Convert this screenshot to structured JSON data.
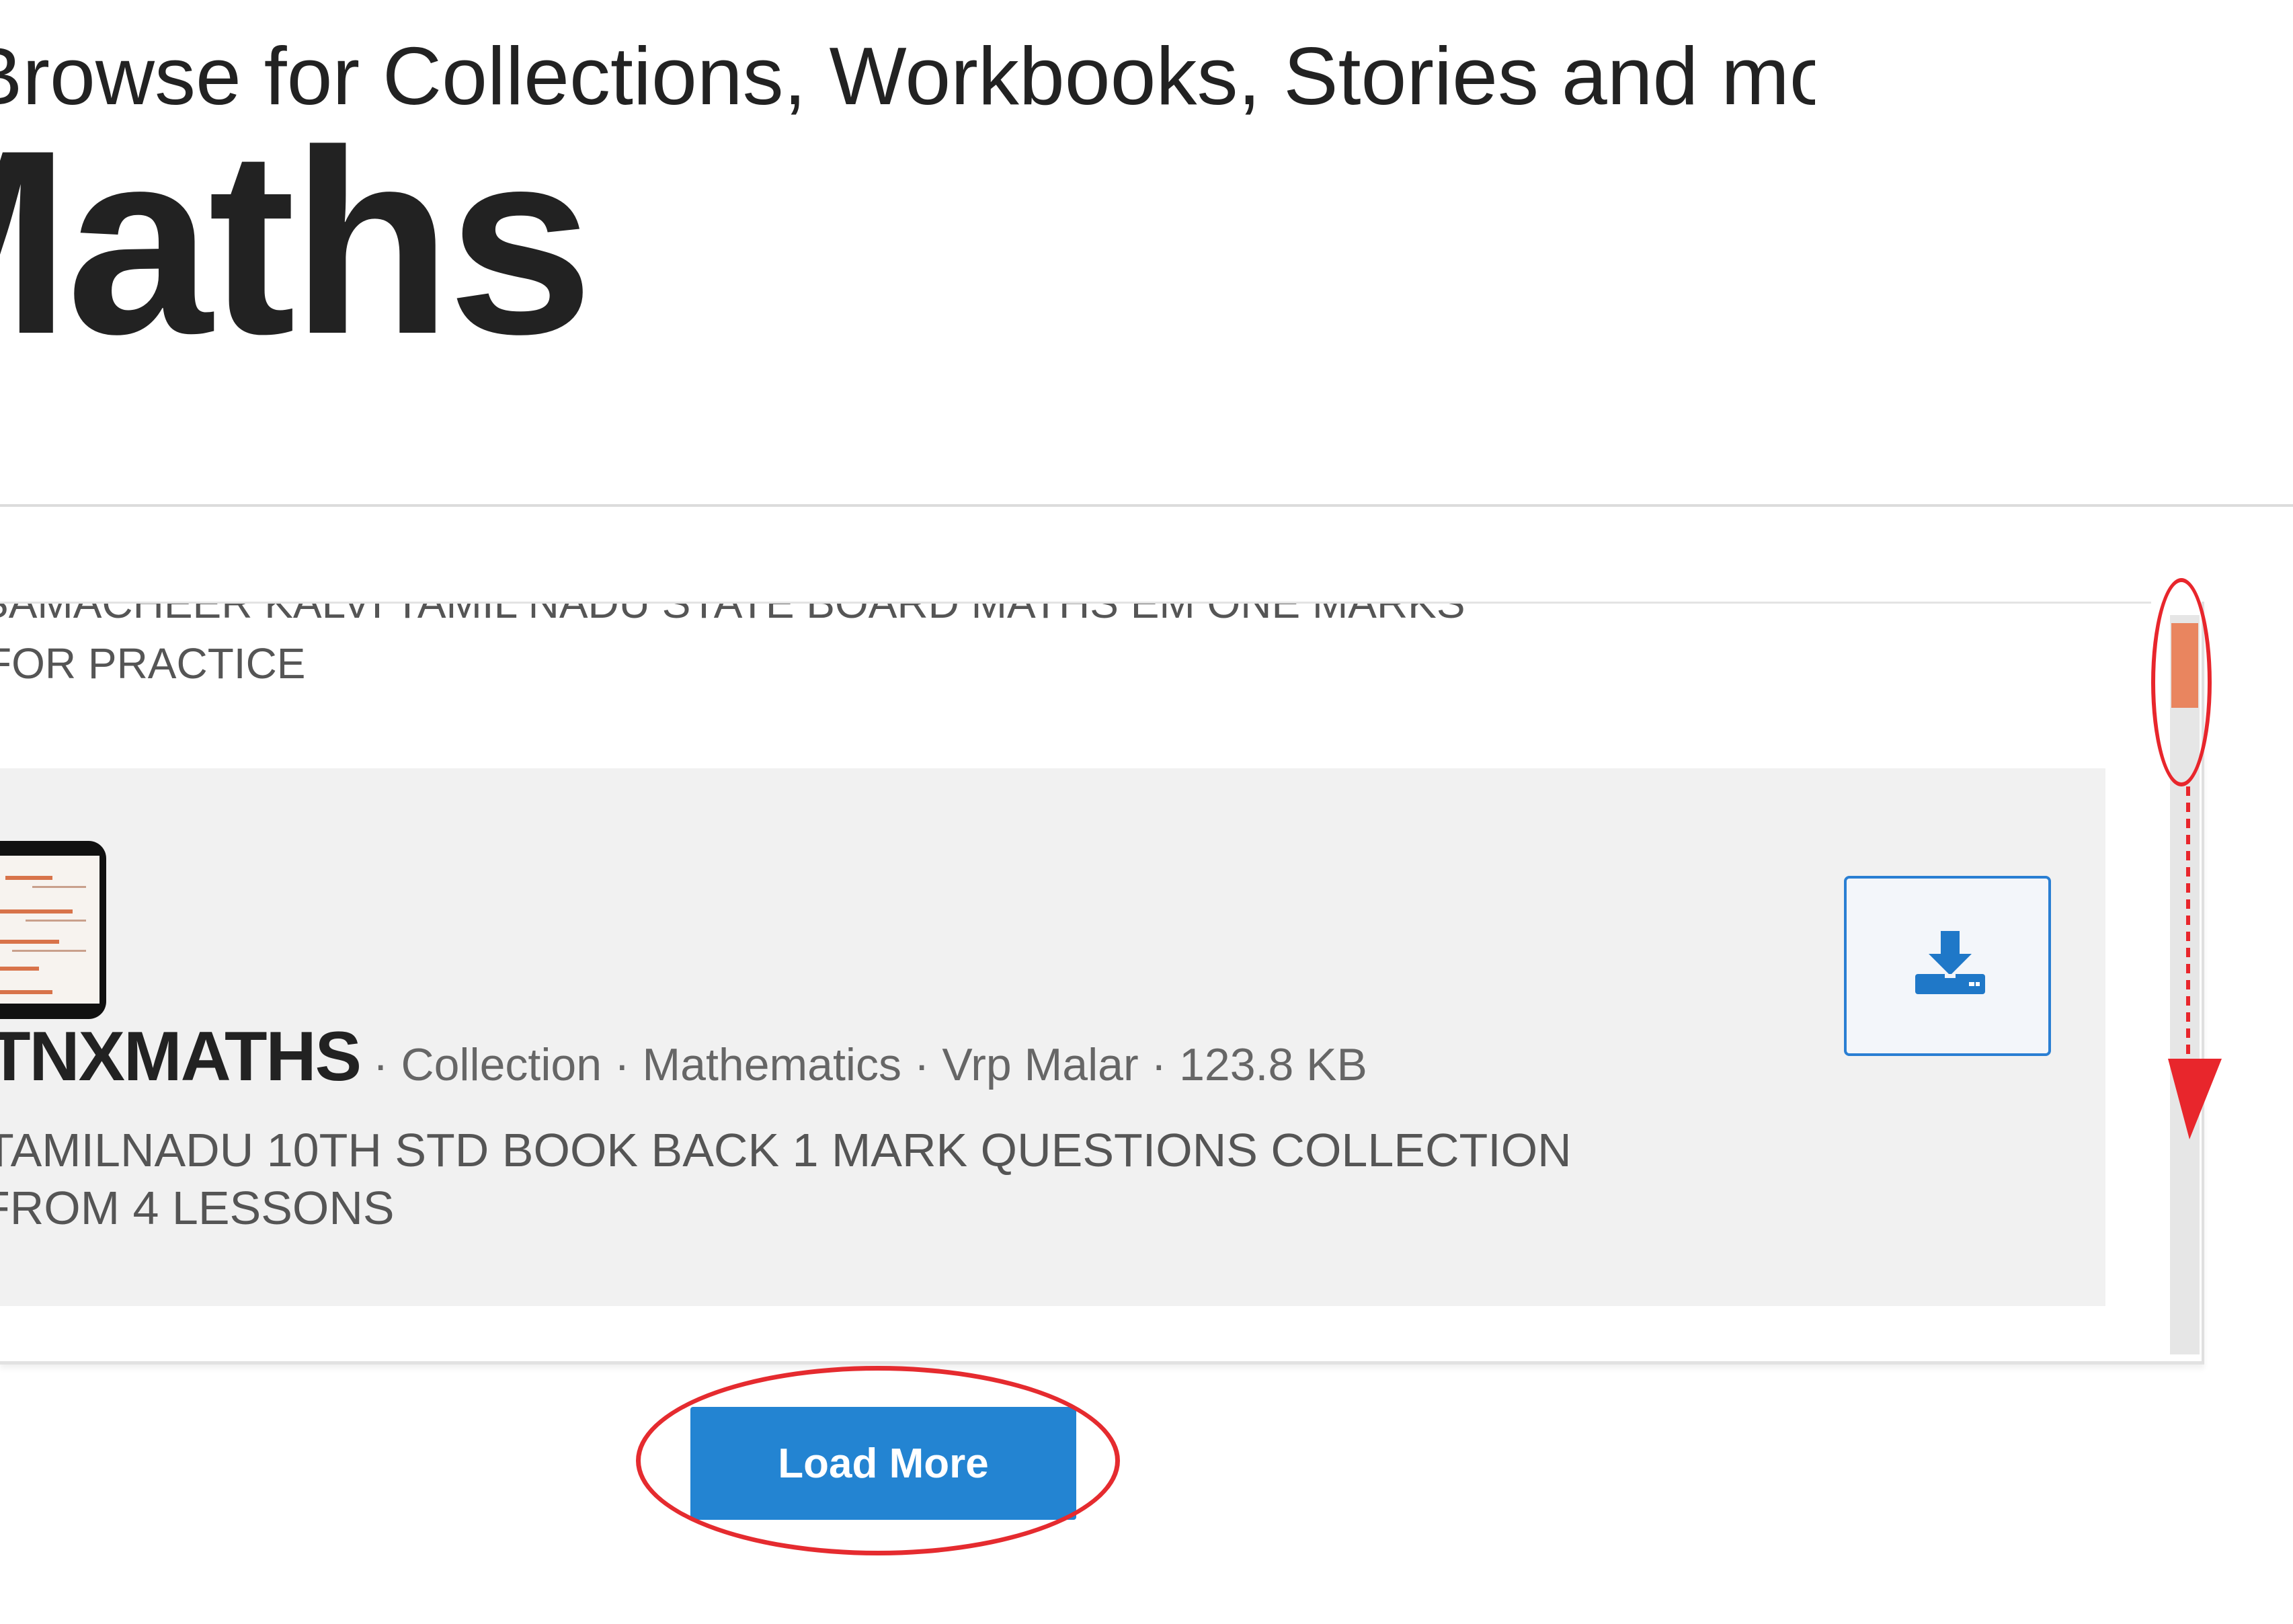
{
  "header": {
    "subheading": "Browse for Collections, Workbooks, Stories and more",
    "title": "Maths"
  },
  "list": {
    "previous_item_description_line1": "SAMACHEER KALVI TAMIL NADU STATE BOARD MATHS EM ONE MARKS",
    "previous_item_description_line2": "FOR PRACTICE",
    "items": [
      {
        "title": "TNXMATHS",
        "separator": " · ",
        "type": "Collection",
        "subject": "Mathematics",
        "author": "Vrp Malar",
        "size": "123.8 KB",
        "description_line1": "TAMILNADU 10TH STD BOOK BACK 1 MARK QUESTIONS COLLECTION",
        "description_line2": "FROM 4 LESSONS"
      }
    ],
    "scroll_position": 0.02
  },
  "actions": {
    "load_more_label": "Load More"
  },
  "icons": {
    "download": "download-icon"
  },
  "colors": {
    "accent": "#2384d2",
    "scroll_thumb": "#e9855f",
    "highlight": "#e52b2f"
  }
}
